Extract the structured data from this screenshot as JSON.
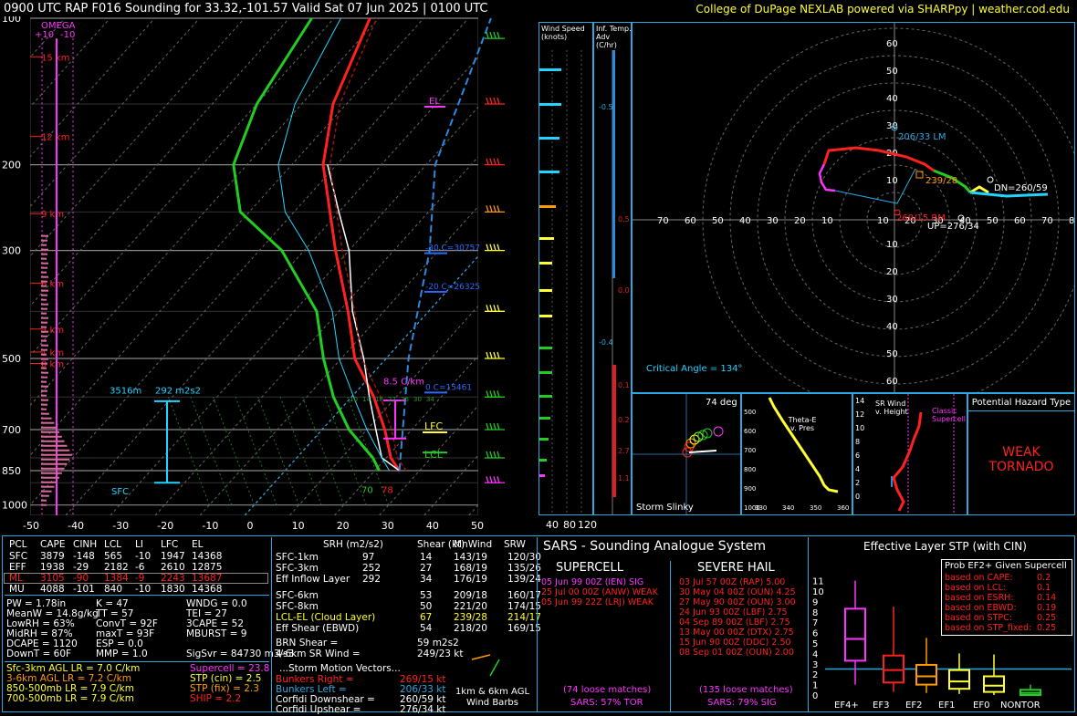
{
  "header": {
    "title": "0900 UTC RAP F016 Sounding for 33.32,-101.57 Valid  Sat 07 Jun 2025 | 0100 UTC",
    "credit": "College of DuPage NEXLAB powered via SHARPpy | weather.cod.edu"
  },
  "colors": {
    "temp": "#ff2020",
    "dewp": "#22cc22",
    "parcel": "#ffffff",
    "virt": "#ff4040",
    "wetbulb": "#22d4ff",
    "accent": "#2aa8e0",
    "magenta": "#ff33ff",
    "yellow": "#ffff33"
  },
  "skewt": {
    "pressure_ticks": [
      "100",
      "200",
      "300",
      "500",
      "700",
      "850",
      "1000"
    ],
    "temp_ticks": [
      "-50",
      "-40",
      "-30",
      "-20",
      "-10",
      "0",
      "10",
      "20",
      "30",
      "40",
      "50"
    ],
    "height_labels": [
      "15 km",
      "12 km",
      "9 km",
      "6 km",
      "3 km",
      "1 km",
      "0 km"
    ],
    "omega_label": "OMEGA",
    "omega_ticks": [
      "+10",
      "-10"
    ],
    "el_label": "EL",
    "lfc_label": "LFC",
    "lcl_label": "LCL",
    "m30c_label": "-30 C=30757",
    "m20c_label": "-20 C=26325",
    "zeroc_label": "0 C=15461",
    "lr_label": "8.5 C/km",
    "eff_inflow_depth": "3516m",
    "eff_inflow_srh": "292 m2s2",
    "sfc_label": "SFC",
    "sfc_t": "78",
    "sfc_td": "70",
    "mix_ticks": [
      "10",
      "14",
      "18",
      "22",
      "26",
      "30",
      "34"
    ]
  },
  "chart_data": {
    "type": "line",
    "title": "",
    "xlabel": "",
    "ylabel": "",
    "x_axis": "temperature (C)",
    "y_axis": "pressure (mb), log, inverted",
    "xlim": [
      -50,
      50
    ],
    "ylim": [
      1050,
      100
    ],
    "series": [
      {
        "name": "",
        "key": "temperature",
        "points": [
          [
            850,
            25.5
          ],
          [
            800,
            21
          ],
          [
            700,
            14
          ],
          [
            600,
            5
          ],
          [
            500,
            -7
          ],
          [
            400,
            -18
          ],
          [
            300,
            -33
          ],
          [
            250,
            -42
          ],
          [
            200,
            -53
          ],
          [
            150,
            -63
          ],
          [
            100,
            -72
          ]
        ]
      },
      {
        "name": "",
        "key": "dewpoint",
        "points": [
          [
            850,
            21
          ],
          [
            800,
            17
          ],
          [
            700,
            6
          ],
          [
            600,
            -4
          ],
          [
            500,
            -14
          ],
          [
            400,
            -25
          ],
          [
            300,
            -45
          ],
          [
            250,
            -62
          ],
          [
            200,
            -73
          ],
          [
            150,
            -80
          ],
          [
            100,
            -85
          ]
        ]
      },
      {
        "name": "",
        "key": "parcel",
        "points": [
          [
            850,
            25.5
          ],
          [
            800,
            19
          ],
          [
            700,
            12
          ],
          [
            600,
            4
          ],
          [
            500,
            -5
          ],
          [
            400,
            -17
          ],
          [
            300,
            -30
          ],
          [
            250,
            -40
          ],
          [
            200,
            -52
          ]
        ]
      }
    ]
  },
  "wind_panel": {
    "title": "Wind Speed (knots)",
    "ticks": [
      "40",
      "80",
      "120"
    ]
  },
  "temp_adv_panel": {
    "title": "Inf. Temp. Adv (C/hr)",
    "values": [
      "-0.5",
      "0.5",
      "0.0",
      "-0.4",
      "0.1",
      "0.2",
      "2.7",
      "1.1"
    ]
  },
  "hodograph": {
    "ticks_left": [
      "70",
      "60",
      "50",
      "40",
      "30",
      "20",
      "10"
    ],
    "ticks_right": [
      "10",
      "20",
      "30",
      "40",
      "50",
      "60",
      "70",
      "80"
    ],
    "ticks_up": [
      "60",
      "50",
      "40",
      "30",
      "20",
      "10"
    ],
    "ticks_down": [
      "10",
      "20",
      "30",
      "40",
      "50",
      "60"
    ],
    "lm_label": "206/33 LM",
    "rm_label": "269/15 RM",
    "mean_label": "239/28",
    "dn_label": "DN=260/59",
    "up_label": "UP=276/34",
    "critical_angle": "Critical Angle = 134°"
  },
  "slinky": {
    "angle": "74 deg",
    "label": "Storm Slinky"
  },
  "theta_panel": {
    "title": "Theta-E v. Pres",
    "p_ticks": [
      "500",
      "600",
      "700",
      "800",
      "900",
      "1000"
    ],
    "t_ticks": [
      "330",
      "340",
      "350",
      "360"
    ]
  },
  "srwind_panel": {
    "title": "SR Wind v. Height",
    "note": "Classic Supercell",
    "h_ticks": [
      "14",
      "12",
      "10",
      "8",
      "6",
      "4",
      "2",
      "0"
    ]
  },
  "hazard": {
    "title": "Potential Hazard Type",
    "value": "WEAK TORNADO"
  },
  "thermo_table": {
    "headers": [
      "PCL",
      "CAPE",
      "CINH",
      "LCL",
      "LI",
      "LFC",
      "EL"
    ],
    "rows": [
      [
        "SFC",
        "3879",
        "-148",
        "565",
        "-10",
        "1947",
        "14368"
      ],
      [
        "EFF",
        "1938",
        "-29",
        "2182",
        "-6",
        "2610",
        "12875"
      ],
      [
        "ML",
        "3105",
        "-90",
        "1384",
        "-9",
        "2243",
        "13687"
      ],
      [
        "MU",
        "4088",
        "-101",
        "840",
        "-10",
        "1830",
        "14368"
      ]
    ]
  },
  "indices": {
    "left": [
      "PW = 1.78in",
      "MeanW = 14.8g/kg",
      "LowRH = 63%",
      "MidRH = 87%",
      "DCAPE = 1120",
      "DownT = 60F"
    ],
    "mid": [
      "K = 47",
      "TT = 57",
      "ConvT = 92F",
      "maxT = 93F",
      "ESP = 0.0",
      "MMP = 1.0"
    ],
    "right": [
      "WNDG = 0.0",
      "TEI = 27",
      "3CAPE = 52",
      "MBURST = 9",
      "",
      "SigSvr = 84730 m3/s3"
    ]
  },
  "lapse_rates": [
    "Sfc-3km AGL LR = 7.0 C/km",
    "3-6km AGL LR = 7.2 C/km",
    "850-500mb LR = 7.9 C/km",
    "700-500mb LR = 7.9 C/km"
  ],
  "composites": [
    "Supercell = 23.8",
    "STP (cin) = 2.5",
    "STP (fix) = 2.3",
    "SHIP = 2.2"
  ],
  "kin_table": {
    "headers": [
      "SRH (m2/s2)",
      "Shear (kt)",
      "MnWind",
      "SRW"
    ],
    "rows": [
      [
        "SFC-1km",
        "97",
        "14",
        "143/19",
        "120/30"
      ],
      [
        "SFC-3km",
        "252",
        "27",
        "168/19",
        "135/26"
      ],
      [
        "Eff Inflow Layer",
        "292",
        "34",
        "176/19",
        "139/24"
      ],
      [
        "SFC-6km",
        "53",
        "209/18",
        "",
        "160/17"
      ],
      [
        "SFC-8km",
        "50",
        "221/20",
        "",
        "174/15"
      ],
      [
        "LCL-EL (Cloud Layer)",
        "67",
        "239/28",
        "",
        "214/17"
      ],
      [
        "Eff Shear (EBWD)",
        "54",
        "218/20",
        "",
        "169/15"
      ]
    ],
    "brn": "BRN Shear =",
    "brn_val": "59 m2s2",
    "sr46": "4-6km SR Wind =",
    "sr46_val": "249/23 kt",
    "storm_vec": "...Storm Motion Vectors...",
    "vectors": [
      [
        "Bunkers Right =",
        "269/15 kt"
      ],
      [
        "Bunkers Left =",
        "206/33 kt"
      ],
      [
        "Corfidi Downshear =",
        "260/59 kt"
      ],
      [
        "Corfidi Upshear =",
        "276/34 kt"
      ]
    ],
    "barb_label": "1km & 6km AGL Wind Barbs"
  },
  "sars": {
    "title": "SARS - Sounding Analogue System",
    "supercell_title": "SUPERCELL",
    "hail_title": "SEVERE HAIL",
    "supercell": [
      "05 Jun 99 00Z (IEN)   SIG",
      "25 Jul 00 00Z (ANW)   WEAK",
      "05 Jun 99 22Z (LRJ)   WEAK"
    ],
    "hail": [
      "03 Jul 57 00Z (RAP)   5.00",
      "30 May 04 00Z (OUN)  4.25",
      "27 May 90 00Z (OUN)  3.00",
      "24 Jun 93 00Z (LBF)   2.75",
      "04 Sep 89 00Z (LBF)   2.75",
      "13 May 00 00Z (DTX)   2.75",
      "15 Jun 90 00Z (DDC)   2.50",
      "08 Sep 01 00Z (OUN)  2.00"
    ],
    "sc_matches": "(74 loose matches)",
    "hail_matches": "(135 loose matches)",
    "sc_prob": "SARS: 57% TOR",
    "hail_prob": "SARS: 79% SIG"
  },
  "stp": {
    "title": "Effective Layer STP (with CIN)",
    "y_ticks": [
      "11",
      "10",
      "9",
      "8",
      "7",
      "6",
      "5",
      "4",
      "3",
      "2",
      "1",
      "0"
    ],
    "categories": [
      "EF4+",
      "EF3",
      "EF2",
      "EF1",
      "EF0",
      "NONTOR"
    ],
    "prob_title": "Prob EF2+ Given Supercell",
    "probs": [
      [
        "based on CAPE:",
        "0.2"
      ],
      [
        "based on LCL:",
        "0.1"
      ],
      [
        "based on ESRH:",
        "0.14"
      ],
      [
        "based on EBWD:",
        "0.19"
      ],
      [
        "based on STPC:",
        "0.25"
      ],
      [
        "based on STP_fixed:",
        "0.25"
      ]
    ]
  }
}
